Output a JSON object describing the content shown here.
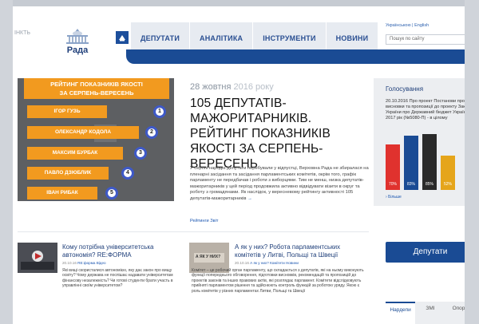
{
  "prev_tag": "ІНКТЬ",
  "header": {
    "logo_text": "Рада",
    "nav": [
      "ДЕПУТАТИ",
      "АНАЛІТИКА",
      "ІНСТРУМЕНТИ",
      "НОВИНИ"
    ],
    "lang_active": "Українською",
    "lang_other": "English",
    "search_placeholder": "Пошук по сайту"
  },
  "rating": {
    "title_line1": "РЕЙТИНГ ПОКАЗНИКІВ ЯКОСТІ",
    "title_line2": "ЗА СЕРПЕНЬ-ВЕРЕСЕНЬ",
    "items": [
      {
        "rank": "1",
        "name": "ІГОР ГУЗЬ"
      },
      {
        "rank": "2",
        "name": "ОЛЕКСАНДР КОДОЛА"
      },
      {
        "rank": "3",
        "name": "МАКСИМ БУРБАК"
      },
      {
        "rank": "4",
        "name": "ПАВЛО ДЗЮБЛИК"
      },
      {
        "rank": "5",
        "name": "ІВАН РИБАК"
      }
    ]
  },
  "main": {
    "date_day": "28 жовтня",
    "date_year": "2016 року",
    "headline": "105 ДЕПУТАТІВ-МАЖОРИТАРНИКІВ. РЕЙТИНГ ПОКАЗНИКІВ ЯКОСТІ ЗА СЕРПЕНЬ-ВЕРЕСЕНЬ",
    "lead": "У серпні народні депутати перебували у відпустці, Верховна Рада не збиралася на пленарні засідання та засідання парламентських комітетів, окрім того, графік парламенту не передбачав і роботи з виборцями. Тим не менш, низка депутатів-мажоритарників у цей період продовжила активно відвідувати візити в округ та роботу з громадянами. Як наслідок, у вересневому рейтингу активності 105 депутатів-мажоритарників",
    "more": "→",
    "tag1": "Рейтинги",
    "tag2": "Звіт"
  },
  "vote": {
    "title": "Голосування",
    "date": "20.10.2016",
    "text": "Про проект Постанови про висновки та пропозиції до проекту Закону України про Державний бюджет України на 2017 рік (№5080-П) - в цілому",
    "more": "Більше",
    "colors": [
      "#e0322e",
      "#1a4b94",
      "#2a2a2a",
      "#e5a51b"
    ],
    "labels": [
      "70%",
      "83%",
      "85%",
      "52%"
    ],
    "values": [
      70,
      83,
      85,
      52
    ]
  },
  "deputies_button": "Депутати",
  "tabs": [
    "Нардепи",
    "ЗМІ",
    "Опора"
  ],
  "bottom": [
    {
      "title": "Кому потрібна університетська автономія? RE:ФОРМА",
      "date": "20.10.16",
      "tag1": "RE:форма",
      "tag2": "Відео",
      "text": "Які вищі скористалися автономією, яку дає закон про вищу освіту? Чому держава не поспішає надавати університетам фінансову незалежність? Чи готові студенти брати участь в управлінні своїм університетом?"
    },
    {
      "title": "А як у них? Робота парламентських комітетів у Литві, Польщі та Швеції",
      "date": "20.10.16",
      "tag1": "А як у них?",
      "tag2": "Комітети",
      "tag3": "Новини",
      "thumb_label": "А ЯК У НИХ?",
      "text": "Комітет – це робочий орган парламенту, що складається з депутатів, які на ньому виконують функції попереднього обговорення, підготовки висновків, рекомендацій та пропозицій до проектів законів та інших правових актів, які розглядає парламент. Комітети відслідковують прийняті парламентом рішення та здійснюють контроль функцій за роботою уряду. Якою є роль комітетів у різних парламентах Литви, Польщі та Швеції"
    }
  ]
}
